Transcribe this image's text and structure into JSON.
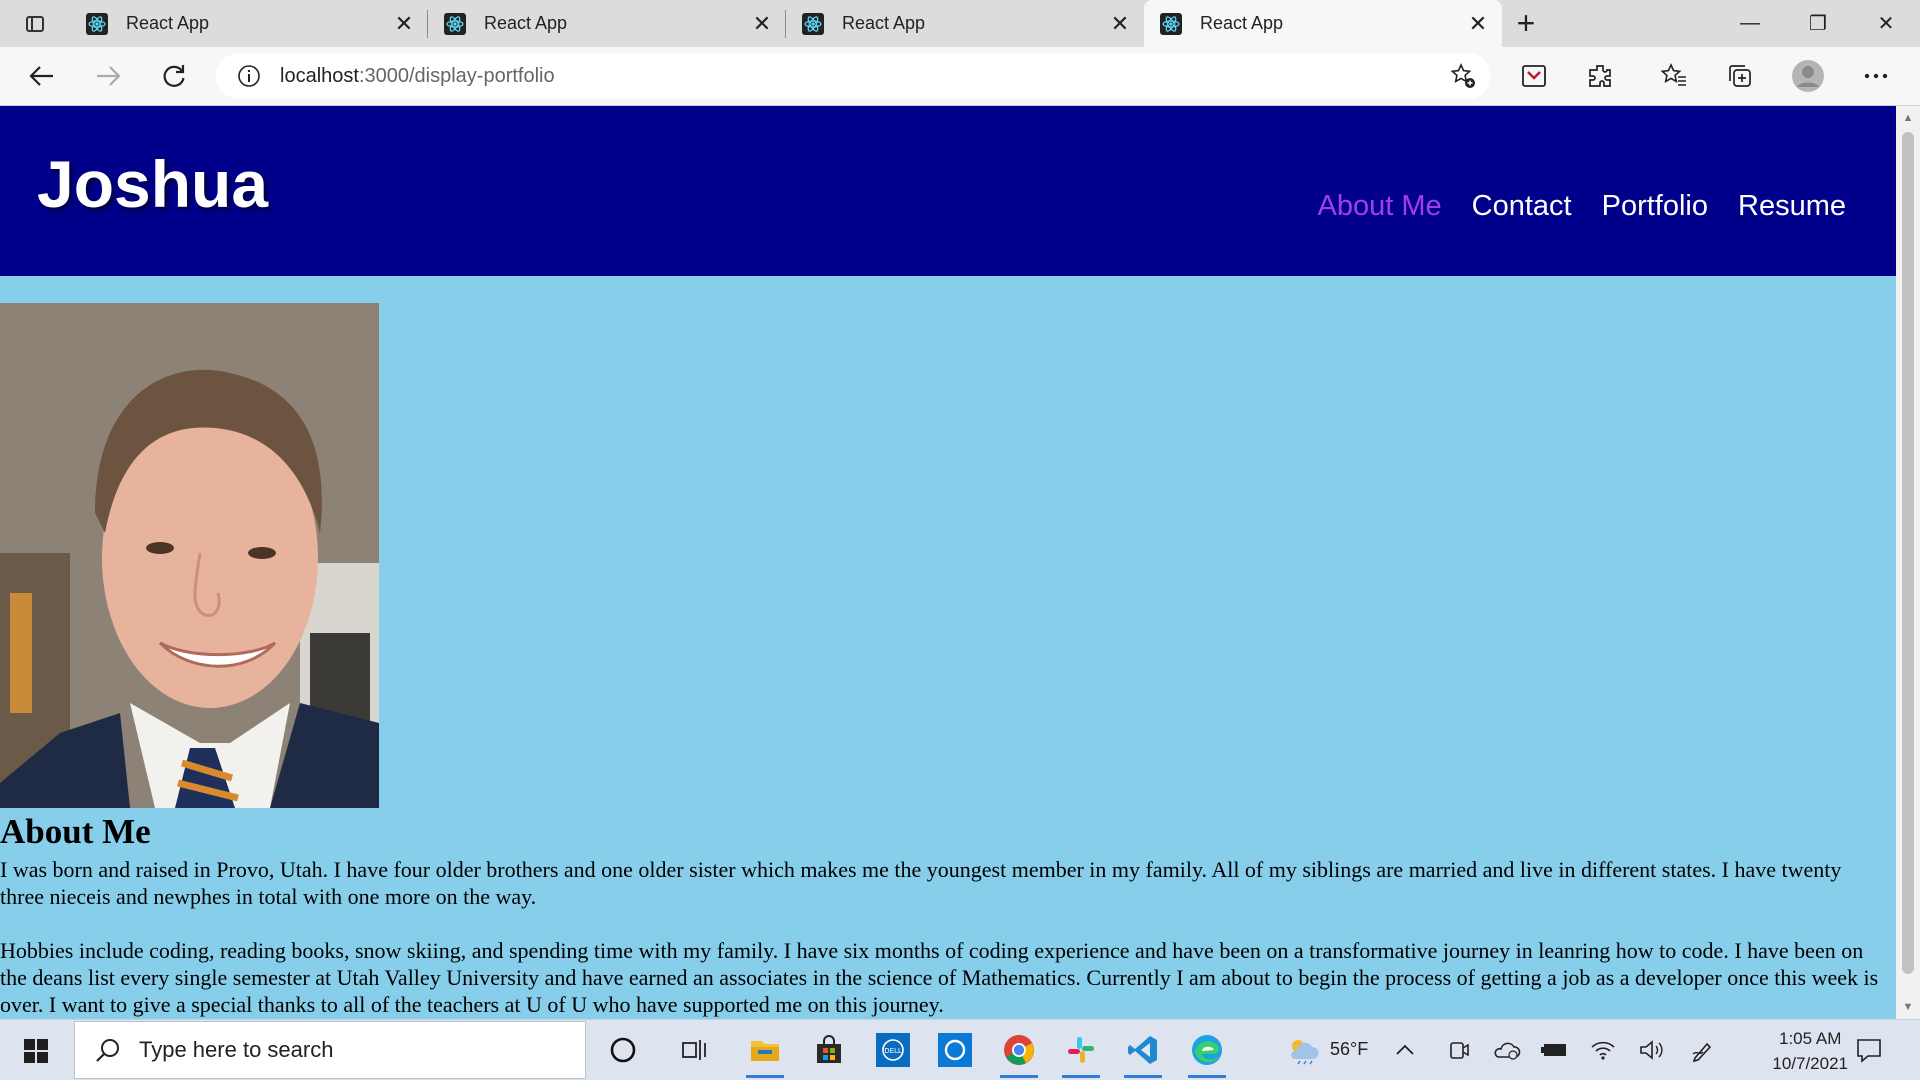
{
  "browser": {
    "tabs": [
      {
        "title": "React App",
        "active": false
      },
      {
        "title": "React App",
        "active": false
      },
      {
        "title": "React App",
        "active": false
      },
      {
        "title": "React App",
        "active": true
      }
    ],
    "url_host": "localhost",
    "url_path": ":3000/display-portfolio"
  },
  "site": {
    "name": "Joshua",
    "nav": [
      {
        "label": "About Me",
        "active": true
      },
      {
        "label": "Contact",
        "active": false
      },
      {
        "label": "Portfolio",
        "active": false
      },
      {
        "label": "Resume",
        "active": false
      }
    ],
    "about_heading": "About Me",
    "paragraphs": [
      "I was born and raised in Provo, Utah. I have four older brothers and one older sister which makes me the youngest member in my family. All of my siblings are married and live in different states. I have twenty three nieceis and newphes in total with one more on the way.",
      "Hobbies include coding, reading books, snow skiing, and spending time with my family. I have six months of coding experience and have been on a transformative journey in leanring how to code. I have been on the deans list every single semester at Utah Valley University and have earned an associates in the science of Mathematics. Currently I am about to begin the process of getting a job as a developer once this week is over. I want to give a special thanks to all of the teachers at U of U who have supported me on this journey."
    ]
  },
  "taskbar": {
    "search_placeholder": "Type here to search",
    "weather": "56°F",
    "time": "1:05 AM",
    "date": "10/7/2021"
  },
  "colors": {
    "header_bg": "#00008b",
    "page_bg": "#87ceeb",
    "nav_active": "#a23cf0"
  }
}
